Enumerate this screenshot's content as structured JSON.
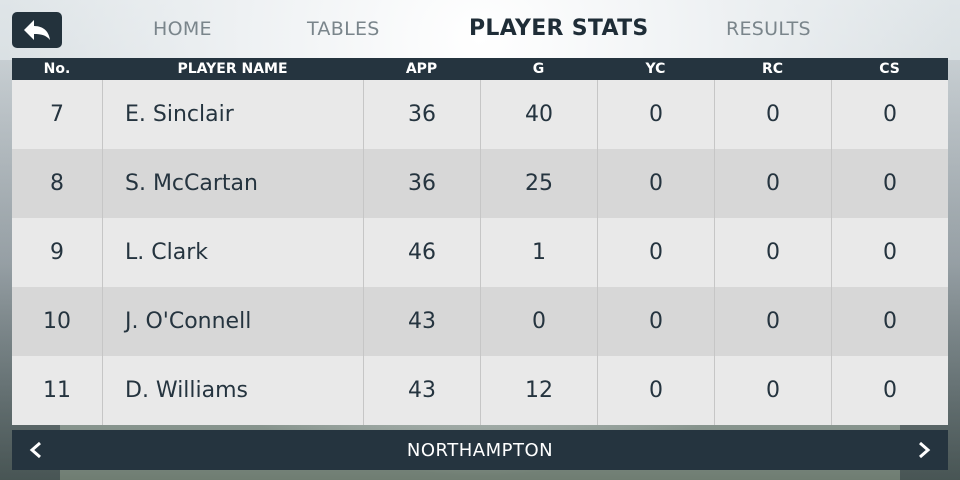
{
  "nav": {
    "tabs": [
      {
        "label": "HOME"
      },
      {
        "label": "TABLES"
      },
      {
        "label": "PLAYER STATS"
      },
      {
        "label": "RESULTS"
      }
    ],
    "active_tab": "PLAYER STATS"
  },
  "table": {
    "headers": [
      "No.",
      "PLAYER NAME",
      "APP",
      "G",
      "YC",
      "RC",
      "CS"
    ],
    "rows": [
      {
        "no": "7",
        "name": "E. Sinclair",
        "app": "36",
        "g": "40",
        "yc": "0",
        "rc": "0",
        "cs": "0"
      },
      {
        "no": "8",
        "name": "S. McCartan",
        "app": "36",
        "g": "25",
        "yc": "0",
        "rc": "0",
        "cs": "0"
      },
      {
        "no": "9",
        "name": "L. Clark",
        "app": "46",
        "g": "1",
        "yc": "0",
        "rc": "0",
        "cs": "0"
      },
      {
        "no": "10",
        "name": "J. O'Connell",
        "app": "43",
        "g": "0",
        "yc": "0",
        "rc": "0",
        "cs": "0"
      },
      {
        "no": "11",
        "name": "D. Williams",
        "app": "43",
        "g": "12",
        "yc": "0",
        "rc": "0",
        "cs": "0"
      }
    ]
  },
  "footer": {
    "team": "NORTHAMPTON"
  },
  "icons": {
    "back": "back-arrow-icon",
    "prev": "chevron-left-icon",
    "next": "chevron-right-icon"
  },
  "colors": {
    "header_bg": "#25343f",
    "row_light": "#e9e9e9",
    "row_dark": "#d7d7d7",
    "text_dark": "#25343f",
    "tab_inactive": "#7a858b"
  }
}
